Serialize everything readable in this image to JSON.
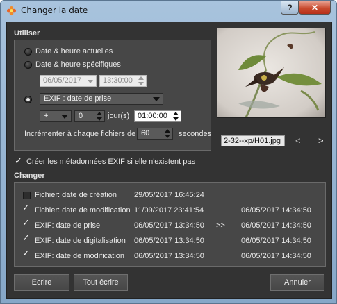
{
  "window": {
    "title": "Changer la date",
    "help_glyph": "?",
    "close_glyph": "✕"
  },
  "utiliser": {
    "heading": "Utiliser",
    "radio_current": "Date & heure actuelles",
    "radio_specific": "Date & heure spécifiques",
    "specific_date": "06/05/2017",
    "specific_time": "13:30:00",
    "exif_source": "EXIF : date de prise",
    "operator": "+",
    "days_value": "0",
    "days_label": "jour(s)",
    "offset_time": "01:00:00",
    "increment_label": "Incrémenter à chaque fichiers de",
    "increment_value": "60",
    "increment_unit": "secondes",
    "selected_option": "exif"
  },
  "preview": {
    "filename": "2-32--xp/H01.jpg",
    "prev_glyph": "<",
    "next_glyph": ">"
  },
  "create_exif": {
    "label": "Créer les métadonnées EXIF si elle n'existent pas",
    "checked": true
  },
  "changer": {
    "heading": "Changer",
    "arrow_label": ">>",
    "rows": [
      {
        "label": "Fichier: date de création",
        "current": "29/05/2017 16:45:24",
        "new": "",
        "checked": false
      },
      {
        "label": "Fichier: date de modification",
        "current": "11/09/2017 23:41:54",
        "new": "06/05/2017 14:34:50",
        "checked": true
      },
      {
        "label": "EXIF: date de prise",
        "current": "06/05/2017 13:34:50",
        "new": "06/05/2017 14:34:50",
        "checked": true
      },
      {
        "label": "EXIF: date de digitalisation",
        "current": "06/05/2017 13:34:50",
        "new": "06/05/2017 14:34:50",
        "checked": true
      },
      {
        "label": "EXIF: date de modification",
        "current": "06/05/2017 13:34:50",
        "new": "06/05/2017 14:34:50",
        "checked": true
      }
    ]
  },
  "buttons": {
    "write": "Ecrire",
    "write_all": "Tout écrire",
    "cancel": "Annuler"
  },
  "colors": {
    "dialog_bg": "#333333",
    "panel_bg": "#474747",
    "close_red": "#c84a2e",
    "title_blue": "#a8c3dd"
  },
  "icons": {
    "app": "flower-app-icon",
    "check": "checkmark-icon"
  }
}
